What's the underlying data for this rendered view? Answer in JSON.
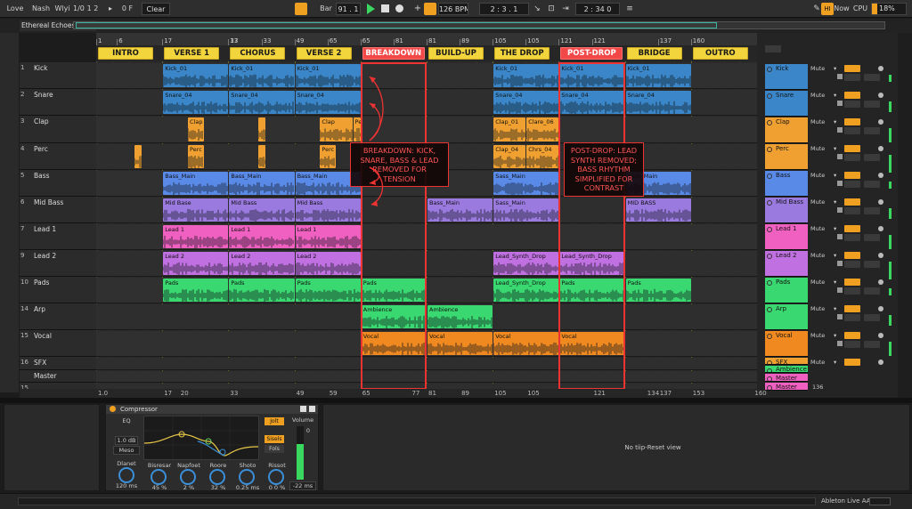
{
  "toolbar": {
    "menu": [
      "Love",
      "Nash",
      "Wlyi"
    ],
    "meter": "1/0",
    "sig": "1 2",
    "arrange_icon": "▸",
    "ratio": "0 F",
    "clear": "Clear",
    "bar_label": "Bar",
    "bar_value": "91 . 1",
    "tempo": "126 BPM",
    "position": "2 :   3 .   1",
    "loop_pos": "2 :   34   0",
    "now": "Now",
    "cpu_label": "CPU",
    "cpu_value": "18%",
    "hw": "HI"
  },
  "project": {
    "title": "Ethereal Echoes"
  },
  "ruler": {
    "top_bars": [
      "1",
      "6",
      "17",
      "33",
      "49",
      "65",
      "81",
      "97",
      "113",
      "129",
      "145",
      "160"
    ],
    "bottom_bars": [
      "1.0",
      "17",
      "20",
      "33",
      "49",
      "59",
      "65",
      "77",
      "81",
      "89",
      "105",
      "105",
      "121",
      "134",
      "137",
      "153",
      "160"
    ]
  },
  "top_ruler_marks": [
    {
      "t": "1",
      "b": 1
    },
    {
      "t": "6",
      "b": 6
    },
    {
      "t": "17",
      "b": 17
    },
    {
      "t": "33",
      "b": 33
    },
    {
      "t": "17",
      "b": 33
    },
    {
      "t": "33",
      "b": 41
    },
    {
      "t": "49",
      "b": 49
    },
    {
      "t": "65",
      "b": 57
    },
    {
      "t": "65",
      "b": 65
    },
    {
      "t": "81",
      "b": 73
    },
    {
      "t": "81",
      "b": 81
    },
    {
      "t": "89",
      "b": 89
    },
    {
      "t": "105",
      "b": 97
    },
    {
      "t": "105",
      "b": 105
    },
    {
      "t": "121",
      "b": 113
    },
    {
      "t": "121",
      "b": 121
    },
    {
      "t": "137",
      "b": 137
    },
    {
      "t": "160",
      "b": 145
    }
  ],
  "sections": [
    {
      "name": "INTRO",
      "start": 1,
      "color": "#f2d43c"
    },
    {
      "name": "VERSE 1",
      "start": 17,
      "color": "#f2d43c"
    },
    {
      "name": "CHORUS",
      "start": 33,
      "color": "#f2d43c"
    },
    {
      "name": "VERSE 2",
      "start": 49,
      "color": "#f2d43c"
    },
    {
      "name": "BREAKDOWN",
      "start": 65,
      "color": "#e84040"
    },
    {
      "name": "BUILD-UP",
      "start": 81,
      "color": "#f2d43c"
    },
    {
      "name": "THE DROP",
      "start": 97,
      "color": "#f2d43c"
    },
    {
      "name": "POST-DROP",
      "start": 113,
      "color": "#e84040"
    },
    {
      "name": "BRIDGE",
      "start": 129,
      "color": "#f2d43c"
    },
    {
      "name": "OUTRO",
      "start": 145,
      "color": "#f2d43c"
    }
  ],
  "tracks": [
    {
      "num": "1",
      "name": "Kick",
      "color": "#3a86c8",
      "mix_name": "Kick",
      "mix_color": "#3a86c8",
      "clips": [
        {
          "s": 17,
          "e": 33,
          "n": "Kick_01"
        },
        {
          "s": 33,
          "e": 49,
          "n": "Kick_01"
        },
        {
          "s": 49,
          "e": 65,
          "n": "Kick_01"
        },
        {
          "s": 97,
          "e": 113,
          "n": "Kick_01"
        },
        {
          "s": 113,
          "e": 129,
          "n": "Kick_01"
        },
        {
          "s": 129,
          "e": 145,
          "n": "Kick_01"
        }
      ]
    },
    {
      "num": "2",
      "name": "Snare",
      "color": "#3a86c8",
      "mix_name": "Snare",
      "mix_color": "#3a86c8",
      "clips": [
        {
          "s": 17,
          "e": 33,
          "n": "Snare_04"
        },
        {
          "s": 33,
          "e": 49,
          "n": "Snare_04"
        },
        {
          "s": 49,
          "e": 65,
          "n": "Snare_04"
        },
        {
          "s": 97,
          "e": 113,
          "n": "Snare_04"
        },
        {
          "s": 113,
          "e": 129,
          "n": "Snare_04"
        },
        {
          "s": 129,
          "e": 145,
          "n": "Snare_04"
        }
      ]
    },
    {
      "num": "3",
      "name": "Clap",
      "color": "#f0a030",
      "mix_name": "Clap",
      "mix_color": "#f0a030",
      "clips": [
        {
          "s": 23,
          "e": 27,
          "n": "Clap"
        },
        {
          "s": 40,
          "e": 42,
          "n": ""
        },
        {
          "s": 55,
          "e": 63,
          "n": "Clap"
        },
        {
          "s": 63,
          "e": 65,
          "n": "Per"
        },
        {
          "s": 97,
          "e": 105,
          "n": "Clap_01"
        },
        {
          "s": 105,
          "e": 113,
          "n": "Clare_06"
        }
      ]
    },
    {
      "num": "4",
      "name": "Perc",
      "color": "#f0a030",
      "mix_name": "Perc",
      "mix_color": "#f0a030",
      "clips": [
        {
          "s": 10,
          "e": 12,
          "n": ""
        },
        {
          "s": 23,
          "e": 27,
          "n": "Perc"
        },
        {
          "s": 40,
          "e": 42,
          "n": ""
        },
        {
          "s": 55,
          "e": 59,
          "n": "Perc"
        },
        {
          "s": 97,
          "e": 105,
          "n": "Clap_04"
        },
        {
          "s": 105,
          "e": 113,
          "n": "Chrs_04"
        }
      ]
    },
    {
      "num": "5",
      "name": "Bass",
      "color": "#5a8ae8",
      "mix_name": "Bass",
      "mix_color": "#5a8ae8",
      "clips": [
        {
          "s": 17,
          "e": 33,
          "n": "Bass_Main"
        },
        {
          "s": 33,
          "e": 49,
          "n": "Bass_Main"
        },
        {
          "s": 49,
          "e": 65,
          "n": "Bass_Main"
        },
        {
          "s": 97,
          "e": 113,
          "n": "Sass_Main"
        },
        {
          "s": 129,
          "e": 145,
          "n": "Sass_Main"
        }
      ]
    },
    {
      "num": "6",
      "name": "Mid Bass",
      "color": "#9b7ae0",
      "mix_name": "Mid Bass",
      "mix_color": "#9b7ae0",
      "clips": [
        {
          "s": 17,
          "e": 33,
          "n": "Mid Base"
        },
        {
          "s": 33,
          "e": 49,
          "n": "Mid Bass"
        },
        {
          "s": 49,
          "e": 65,
          "n": "Mid Bass"
        },
        {
          "s": 81,
          "e": 97,
          "n": "Bass_Main"
        },
        {
          "s": 97,
          "e": 113,
          "n": "Sass_Main"
        },
        {
          "s": 129,
          "e": 145,
          "n": "MID BASS"
        }
      ]
    },
    {
      "num": "7",
      "name": "Lead 1",
      "color": "#f060c0",
      "mix_name": "Lead 1",
      "mix_color": "#f060c0",
      "clips": [
        {
          "s": 17,
          "e": 33,
          "n": "Lead 1"
        },
        {
          "s": 33,
          "e": 49,
          "n": "Lead 1"
        },
        {
          "s": 49,
          "e": 65,
          "n": "Lead 1"
        }
      ]
    },
    {
      "num": "9",
      "name": "Lead 2",
      "color": "#c070e0",
      "mix_name": "Lead 2",
      "mix_color": "#c070e0",
      "clips": [
        {
          "s": 17,
          "e": 33,
          "n": "Lead 2"
        },
        {
          "s": 33,
          "e": 49,
          "n": "Lead 2"
        },
        {
          "s": 49,
          "e": 65,
          "n": "Lead 2"
        },
        {
          "s": 97,
          "e": 113,
          "n": "Lead_Synth_Drop"
        },
        {
          "s": 113,
          "e": 129,
          "n": "Lead_Synth_Drop"
        }
      ]
    },
    {
      "num": "10",
      "name": "Pads",
      "color": "#3ad870",
      "mix_name": "Pads",
      "mix_color": "#3ad870",
      "clips": [
        {
          "s": 17,
          "e": 33,
          "n": "Pads"
        },
        {
          "s": 33,
          "e": 49,
          "n": "Pads"
        },
        {
          "s": 49,
          "e": 65,
          "n": "Pads"
        },
        {
          "s": 65,
          "e": 81,
          "n": "Pads"
        },
        {
          "s": 97,
          "e": 113,
          "n": "Lead_Synth_Drop"
        },
        {
          "s": 113,
          "e": 129,
          "n": "Pads"
        },
        {
          "s": 129,
          "e": 145,
          "n": "Pads"
        }
      ]
    },
    {
      "num": "14",
      "name": "Arp",
      "color": "#3ad870",
      "mix_name": "Arp",
      "mix_color": "#3ad870",
      "clips": [
        {
          "s": 65,
          "e": 81,
          "n": "Ambience"
        },
        {
          "s": 81,
          "e": 97,
          "n": "Ambience"
        }
      ]
    },
    {
      "num": "15",
      "name": "Vocal",
      "color": "#f08a20",
      "mix_name": "Vocal",
      "mix_color": "#f08a20",
      "clips": [
        {
          "s": 65,
          "e": 81,
          "n": "Vocal"
        },
        {
          "s": 81,
          "e": 97,
          "n": "Vocal"
        },
        {
          "s": 97,
          "e": 113,
          "n": "Vocal"
        },
        {
          "s": 113,
          "e": 129,
          "n": "Vocal"
        }
      ]
    },
    {
      "num": "16",
      "name": "SFX",
      "color": "#f0a030",
      "mix_name": "SFX",
      "mix_color": "#f0a030",
      "clips": []
    },
    {
      "num": "",
      "name": "Master",
      "color": "#888",
      "mix_name": "Master",
      "mix_color": "#f060c0",
      "clips": []
    },
    {
      "num": "15",
      "name": "",
      "color": "#888",
      "mix_name": "Master",
      "mix_color": "#f060c0",
      "clips": []
    }
  ],
  "mixer_extra": {
    "ambience": "Ambience",
    "mute": "Mute",
    "value_136": "136"
  },
  "annotations": [
    {
      "text": "BREAKDOWN: KICK, SNARE, BASS & LEAD REMOVED FOR TENSION"
    },
    {
      "text": "POST-DROP: LEAD SYNTH REMOVED; BASS RHYTHM SIMPLIFIED FOR CONTRAST"
    }
  ],
  "device": {
    "title": "Compressor",
    "eq_label": "EQ",
    "eq_value": "1.0 dB",
    "eq_mode": "Meso",
    "onset_label": "Dlanet",
    "onset_value": "120 ms",
    "knobs": [
      {
        "label": "Bisresar",
        "value": "45 %"
      },
      {
        "label": "Napfoet",
        "value": "2 %"
      },
      {
        "label": "Roore",
        "value": "32 %"
      },
      {
        "label": "Shoto",
        "value": "0.25 ms"
      },
      {
        "label": "Rissot",
        "value": "0 0 %"
      }
    ],
    "btn1": "Sisels",
    "btn2": "Fols",
    "btn3": "Jolt",
    "volume_label": "Volume",
    "volume_value": "-22 ms",
    "meter_top": "0"
  },
  "status": {
    "no_device": "No tiip-Reset view",
    "app": "Ableton Live AA"
  }
}
